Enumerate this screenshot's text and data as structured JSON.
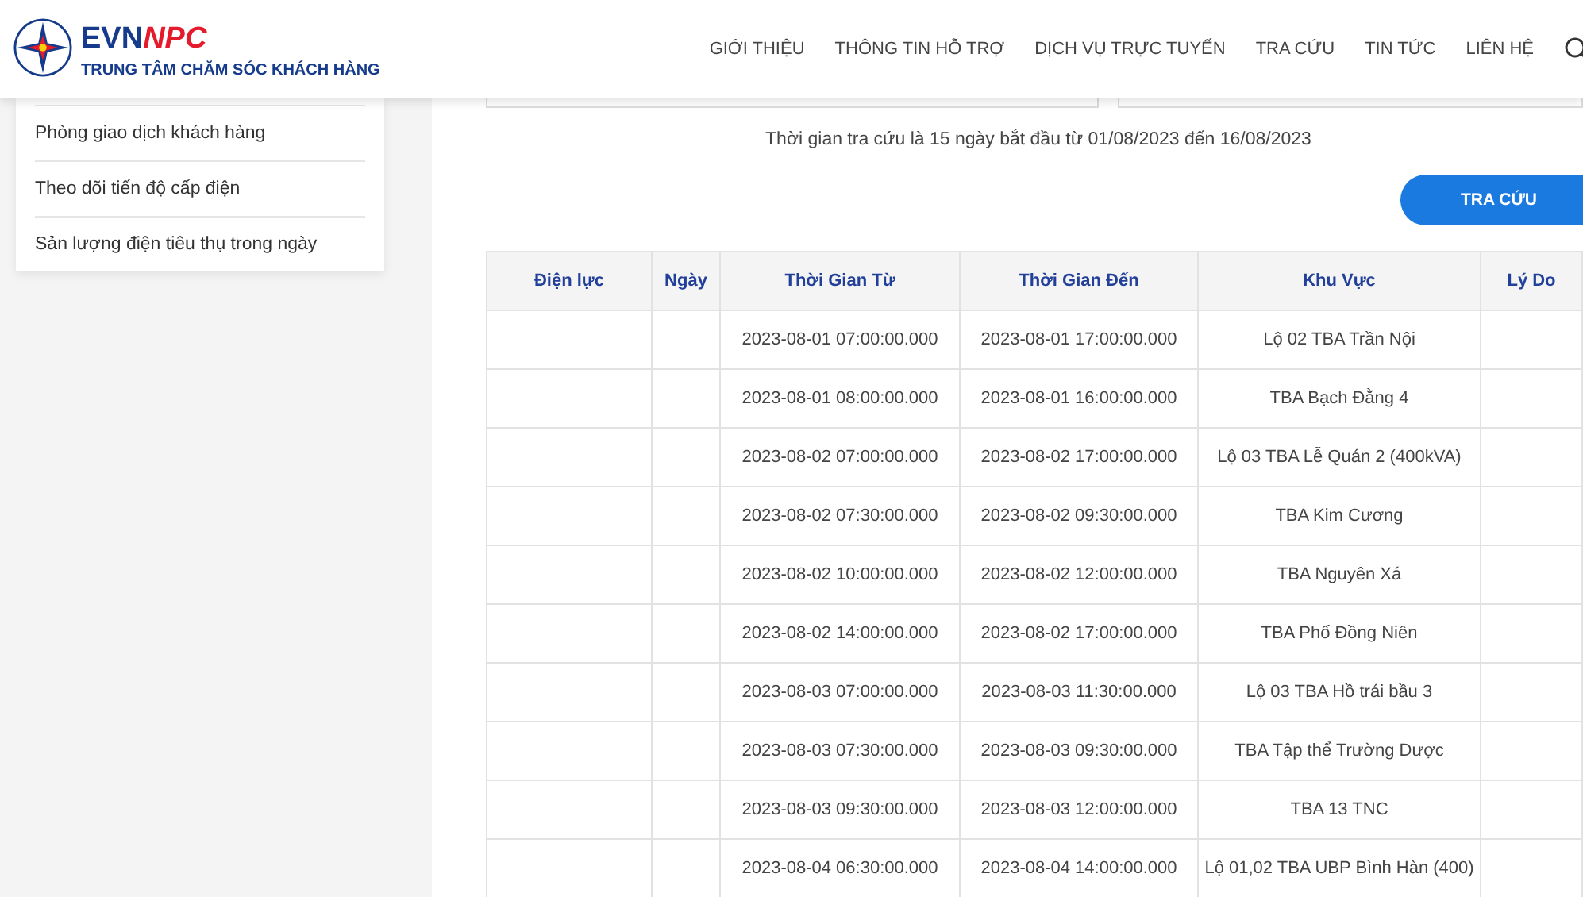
{
  "header": {
    "logo": {
      "brand": "EVN",
      "brand_accent": "NPC",
      "subtitle": "TRUNG TÂM CHĂM SÓC KHÁCH HÀNG"
    },
    "nav": [
      "GIỚI THIỆU",
      "THÔNG TIN HỖ TRỢ",
      "DỊCH VỤ TRỰC TUYẾN",
      "TRA CỨU",
      "TIN TỨC",
      "LIÊN HỆ"
    ]
  },
  "sidebar": {
    "items": [
      "Phòng giao dịch khách hàng",
      "Theo dõi tiến độ cấp điện",
      "Sản lượng điện tiêu thụ trong ngày"
    ]
  },
  "note": "Thời gian tra cứu là 15 ngày bắt đầu từ 01/08/2023 đến 16/08/2023",
  "search_button": "TRA CỨU",
  "table": {
    "columns": [
      "Điện lực",
      "Ngày",
      "Thời Gian Từ",
      "Thời Gian Đến",
      "Khu Vực",
      "Lý Do"
    ],
    "rows": [
      {
        "from": "2023-08-01 07:00:00.000",
        "to": "2023-08-01 17:00:00.000",
        "area": "Lộ 02 TBA Trần Nội"
      },
      {
        "from": "2023-08-01 08:00:00.000",
        "to": "2023-08-01 16:00:00.000",
        "area": "TBA Bạch Đằng 4"
      },
      {
        "from": "2023-08-02 07:00:00.000",
        "to": "2023-08-02 17:00:00.000",
        "area": "Lộ 03 TBA Lễ Quán 2 (400kVA)"
      },
      {
        "from": "2023-08-02 07:30:00.000",
        "to": "2023-08-02 09:30:00.000",
        "area": "TBA Kim Cương"
      },
      {
        "from": "2023-08-02 10:00:00.000",
        "to": "2023-08-02 12:00:00.000",
        "area": "TBA Nguyên Xá"
      },
      {
        "from": "2023-08-02 14:00:00.000",
        "to": "2023-08-02 17:00:00.000",
        "area": "TBA Phố Đồng Niên"
      },
      {
        "from": "2023-08-03 07:00:00.000",
        "to": "2023-08-03 11:30:00.000",
        "area": "Lộ 03 TBA Hồ trái bầu 3"
      },
      {
        "from": "2023-08-03 07:30:00.000",
        "to": "2023-08-03 09:30:00.000",
        "area": "TBA Tập thể Trường Dược"
      },
      {
        "from": "2023-08-03 09:30:00.000",
        "to": "2023-08-03 12:00:00.000",
        "area": "TBA 13 TNC"
      },
      {
        "from": "2023-08-04 06:30:00.000",
        "to": "2023-08-04 14:00:00.000",
        "area": "Lộ 01,02 TBA UBP Bình Hàn (400)"
      }
    ]
  }
}
